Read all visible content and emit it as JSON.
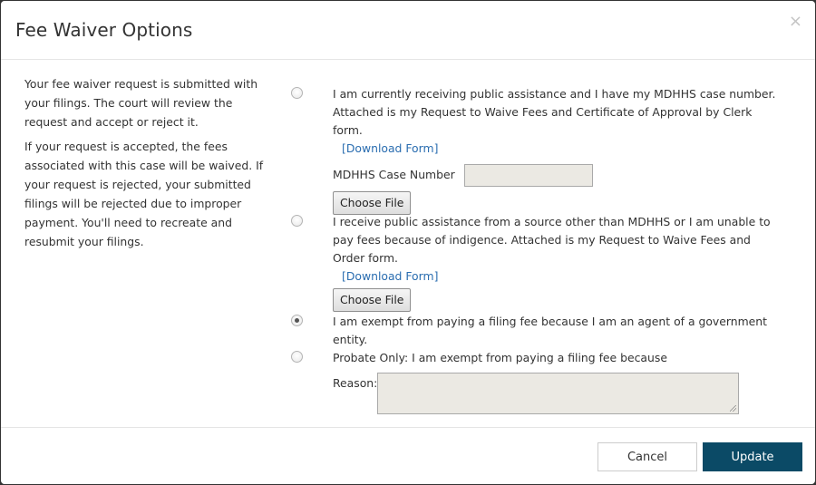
{
  "modal": {
    "title": "Fee Waiver Options",
    "close_icon": "close-icon",
    "close_glyph": "×"
  },
  "intro": {
    "paragraph1": "Your fee waiver request is submitted with your filings. The court will review the request and accept or reject it.",
    "paragraph2": "If your request is accepted, the fees associated with this case will be waived. If your request is rejected, your submitted filings will be rejected due to  improper payment. You'll need to recreate and resubmit your filings."
  },
  "options": [
    {
      "selected": false,
      "text": "I am currently receiving public assistance and I have my MDHHS case number. Attached is my Request to Waive Fees and Certificate of Approval by Clerk form.",
      "link": "[Download Form]",
      "case_number_label": "MDHHS Case Number",
      "case_number_value": "",
      "file_button": "Choose File"
    },
    {
      "selected": false,
      "text": "I receive public assistance from a source other than MDHHS or I am unable to pay fees because of indigence. Attached is my Request to Waive Fees and Order form.",
      "link": "[Download Form]",
      "file_button": "Choose File"
    },
    {
      "selected": true,
      "text": "I am exempt from paying a filing fee because I am an agent of a government entity."
    },
    {
      "selected": false,
      "text": "Probate Only: I am exempt from paying a filing fee because",
      "reason_label": "Reason:",
      "reason_value": ""
    }
  ],
  "footer": {
    "cancel_label": "Cancel",
    "update_label": "Update"
  },
  "colors": {
    "primary": "#0b4a66",
    "link": "#2a6db0",
    "input_bg": "#ebe9e3"
  }
}
